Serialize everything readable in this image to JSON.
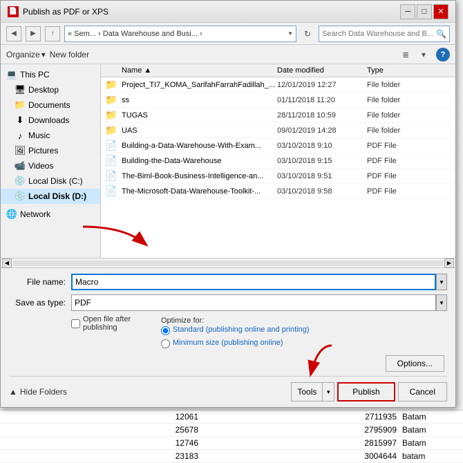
{
  "dialog": {
    "title": "Publish as PDF or XPS",
    "title_icon": "📄"
  },
  "toolbar": {
    "back_label": "◀",
    "forward_label": "▶",
    "up_label": "↑",
    "address": "« Sem... › Data Warehouse and Busi... ›",
    "address_dropdown": "▼",
    "refresh_label": "↻",
    "search_placeholder": "Search Data Warehouse and B...",
    "search_icon": "🔍",
    "organize_label": "Organize",
    "new_folder_label": "New folder",
    "view_icon": "≣",
    "help_label": "?"
  },
  "sidebar": {
    "items": [
      {
        "id": "this-pc",
        "label": "This PC",
        "icon": "💻"
      },
      {
        "id": "desktop",
        "label": "Desktop",
        "icon": "🖥",
        "indent": true
      },
      {
        "id": "documents",
        "label": "Documents",
        "icon": "📁",
        "indent": true
      },
      {
        "id": "downloads",
        "label": "Downloads",
        "icon": "⬇",
        "indent": true
      },
      {
        "id": "music",
        "label": "Music",
        "icon": "♪",
        "indent": true
      },
      {
        "id": "pictures",
        "label": "Pictures",
        "icon": "🖼",
        "indent": true
      },
      {
        "id": "videos",
        "label": "Videos",
        "icon": "📹",
        "indent": true
      },
      {
        "id": "local-disk-c",
        "label": "Local Disk (C:)",
        "icon": "💾",
        "indent": true
      },
      {
        "id": "local-disk-d",
        "label": "Local Disk (D:)",
        "icon": "💾",
        "indent": true,
        "selected": true
      },
      {
        "id": "network",
        "label": "Network",
        "icon": "🌐"
      }
    ]
  },
  "files": {
    "headers": {
      "name": "Name",
      "sort_arrow": "▲",
      "date_modified": "Date modified",
      "type": "Type"
    },
    "items": [
      {
        "name": "Project_TI7_KOMA_SarifahFarrahFadillah_...",
        "icon": "📁",
        "icon_color": "#e8a000",
        "date": "12/01/2019 12:27",
        "type": "File folder"
      },
      {
        "name": "ss",
        "icon": "📁",
        "icon_color": "#e8a000",
        "date": "01/11/2018 11:20",
        "type": "File folder"
      },
      {
        "name": "TUGAS",
        "icon": "📁",
        "icon_color": "#e8a000",
        "date": "28/11/2018 10:59",
        "type": "File folder"
      },
      {
        "name": "UAS",
        "icon": "📁",
        "icon_color": "#e8a000",
        "date": "09/01/2019 14:28",
        "type": "File folder"
      },
      {
        "name": "Building-a-Data-Warehouse-With-Exam...",
        "icon": "📄",
        "icon_color": "#d00",
        "date": "03/10/2018 9:10",
        "type": "PDF File"
      },
      {
        "name": "Building-the-Data-Warehouse",
        "icon": "📄",
        "icon_color": "#d00",
        "date": "03/10/2018 9:15",
        "type": "PDF File"
      },
      {
        "name": "The-Biml-Book-Business-Intelligence-an...",
        "icon": "📄",
        "icon_color": "#d00",
        "date": "03/10/2018 9:51",
        "type": "PDF File"
      },
      {
        "name": "The-Microsoft-Data-Warehouse-Toolkit-...",
        "icon": "📄",
        "icon_color": "#d00",
        "date": "03/10/2018 9:58",
        "type": "PDF File"
      }
    ]
  },
  "form": {
    "filename_label": "File name:",
    "filename_value": "Macro",
    "savetype_label": "Save as type:",
    "savetype_value": "PDF",
    "open_after_label": "Open file after publishing",
    "optimize_label": "Optimize for:",
    "radio_standard_label": "Standard (publishing online and printing)",
    "radio_minimum_label": "Minimum size (publishing online)",
    "options_btn_label": "Options...",
    "tools_label": "Tools",
    "publish_label": "Publish",
    "cancel_label": "Cancel",
    "hide_folders_label": "Hide Folders",
    "hide_folders_icon": "▲"
  },
  "bg_table": {
    "rows": [
      {
        "col1": "12061",
        "col2": "2711935",
        "city": "Batam"
      },
      {
        "col1": "25678",
        "col2": "2795909",
        "city": "Batam"
      },
      {
        "col1": "12746",
        "col2": "2815997",
        "city": "Batam"
      },
      {
        "col1": "23183",
        "col2": "3004644",
        "city": "batam"
      }
    ]
  }
}
